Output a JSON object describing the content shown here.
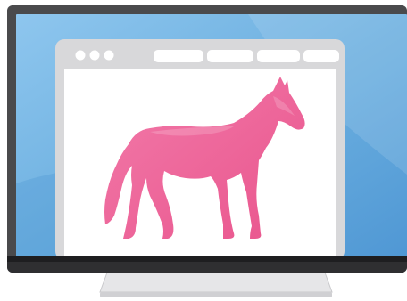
{
  "illustration": {
    "subject": "horse-silhouette",
    "colors": {
      "bezel": "#4a4a4c",
      "bezel_bottom": "#2f2f31",
      "screen_sky": "#6fb1e3",
      "window_chrome": "#d8d8da",
      "window_content": "#ffffff",
      "horse": "#ec5f96",
      "stand": "#e4e4e6"
    },
    "browser_window": {
      "traffic_lights": 3,
      "tabs": 4
    },
    "icons": [
      "monitor-icon",
      "browser-window-icon",
      "horse-icon"
    ]
  }
}
